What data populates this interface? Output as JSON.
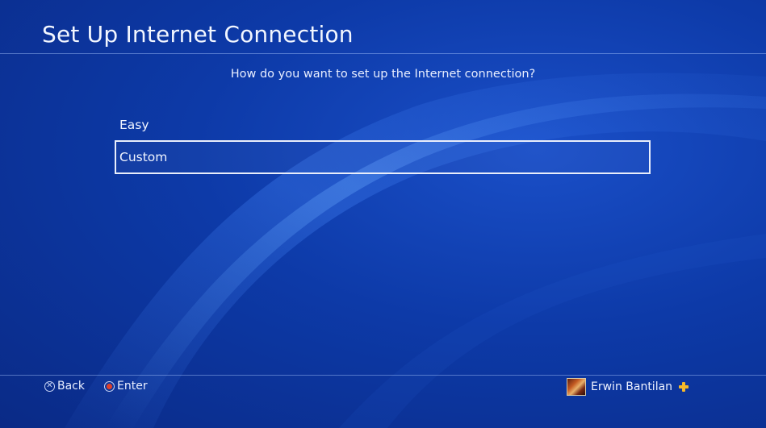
{
  "header": {
    "title": "Set Up Internet Connection"
  },
  "prompt": {
    "question": "How do you want to set up the Internet connection?"
  },
  "options": [
    {
      "label": "Easy",
      "selected": false
    },
    {
      "label": "Custom",
      "selected": true
    }
  ],
  "footer": {
    "back": {
      "label": "Back",
      "icon": "cross-button-icon"
    },
    "enter": {
      "label": "Enter",
      "icon": "circle-button-icon"
    }
  },
  "user": {
    "name": "Erwin Bantilan",
    "badge_icon": "playstation-plus-icon"
  },
  "colors": {
    "background": "#0d3aa8",
    "plus": "#f4b82a",
    "enter_circle": "#e0402a"
  }
}
